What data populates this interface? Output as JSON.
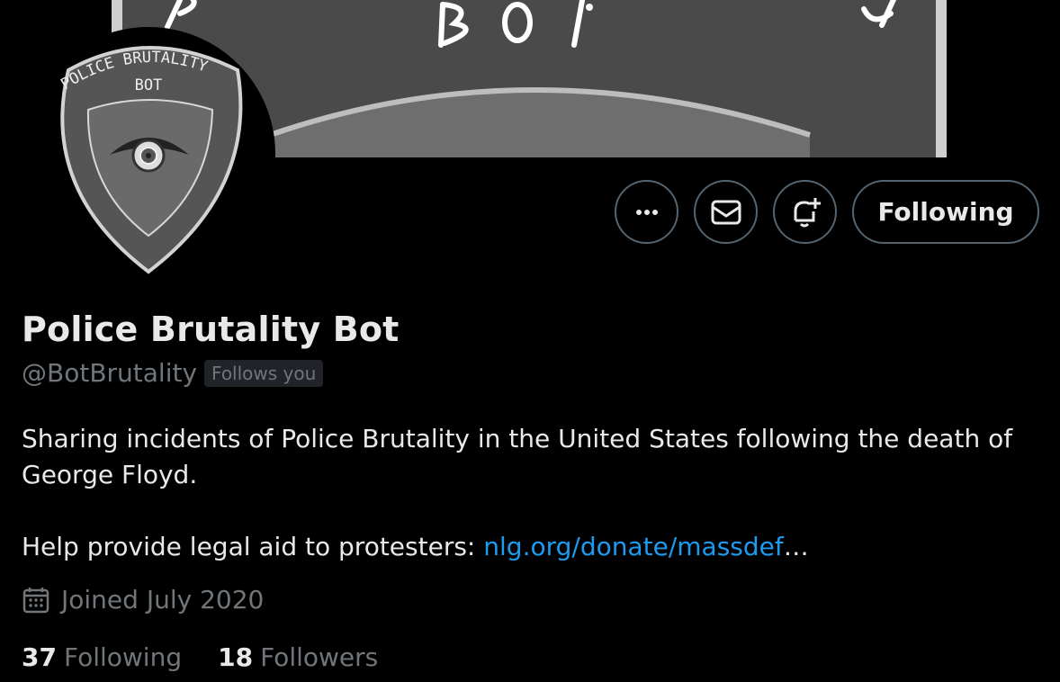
{
  "profile": {
    "display_name": "Police Brutality Bot",
    "handle": "@BotBrutality",
    "follows_you_badge": "Follows you",
    "bio_line1": "Sharing incidents of Police Brutality in the United States following the death of",
    "bio_line2": "George Floyd.",
    "bio_line3_prefix": "Help provide legal aid to protesters: ",
    "bio_link": "nlg.org/donate/massdef",
    "bio_link_suffix": "…",
    "joined": "Joined July 2020"
  },
  "stats": {
    "following_count": "37",
    "following_label": "Following",
    "followers_count": "18",
    "followers_label": "Followers"
  },
  "actions": {
    "more_icon": "more-horizontal-icon",
    "message_icon": "mail-icon",
    "notify_icon": "bell-plus-icon",
    "following_button": "Following"
  },
  "avatar": {
    "text_top": "POLICE BRUTALITY",
    "text_bottom": "BOT"
  },
  "banner": {
    "text": "BOT"
  },
  "colors": {
    "background": "#000000",
    "primary_text": "#e7e9ea",
    "secondary_text": "#71767b",
    "link": "#1d9bf0",
    "border": "#536471",
    "badge_bg": "#202327"
  }
}
